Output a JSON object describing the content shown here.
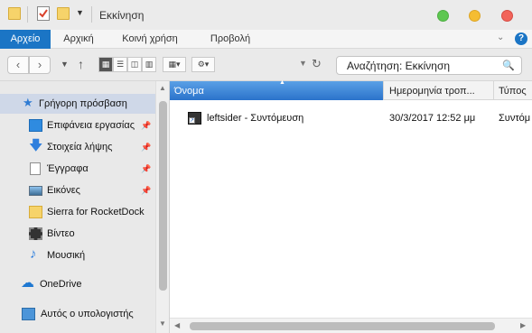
{
  "window": {
    "title": "Εκκίνηση",
    "buttons": {
      "close_color": "#5dc750",
      "minimize_color": "#f5bd32",
      "maximize_color": "#f2645a"
    }
  },
  "ribbon": {
    "tabs": [
      {
        "label": "Αρχείο",
        "active": true
      },
      {
        "label": "Αρχική"
      },
      {
        "label": "Κοινή χρήση"
      },
      {
        "label": "Προβολή"
      }
    ],
    "help_label": "?"
  },
  "toolbar": {
    "search_placeholder": "Αναζήτηση: Εκκίνηση"
  },
  "sidebar": {
    "items": [
      {
        "label": "Γρήγορη πρόσβαση",
        "icon": "star-icon",
        "selected": true
      },
      {
        "label": "Επιφάνεια εργασίας",
        "icon": "desktop-icon",
        "pinned": true
      },
      {
        "label": "Στοιχεία λήψης",
        "icon": "download-icon",
        "pinned": true
      },
      {
        "label": "Έγγραφα",
        "icon": "document-icon",
        "pinned": true
      },
      {
        "label": "Εικόνες",
        "icon": "pictures-icon",
        "pinned": true
      },
      {
        "label": "Sierra for RocketDock",
        "icon": "folder-icon"
      },
      {
        "label": "Βίντεο",
        "icon": "video-icon"
      },
      {
        "label": "Μουσική",
        "icon": "music-icon"
      },
      {
        "label": "OneDrive",
        "icon": "cloud-icon"
      },
      {
        "label": "Αυτός ο υπολογιστής",
        "icon": "computer-icon"
      }
    ]
  },
  "content": {
    "columns": [
      "Όνομα",
      "Ημερομηνία τροπ...",
      "Τύπος"
    ],
    "files": [
      {
        "name": "leftsider - Συντόμευση",
        "date": "30/3/2017 12:52 μμ",
        "type": "Συντόμ"
      }
    ]
  },
  "colors": {
    "accent": "#1b75c5",
    "selection": "#cfd8e8"
  }
}
